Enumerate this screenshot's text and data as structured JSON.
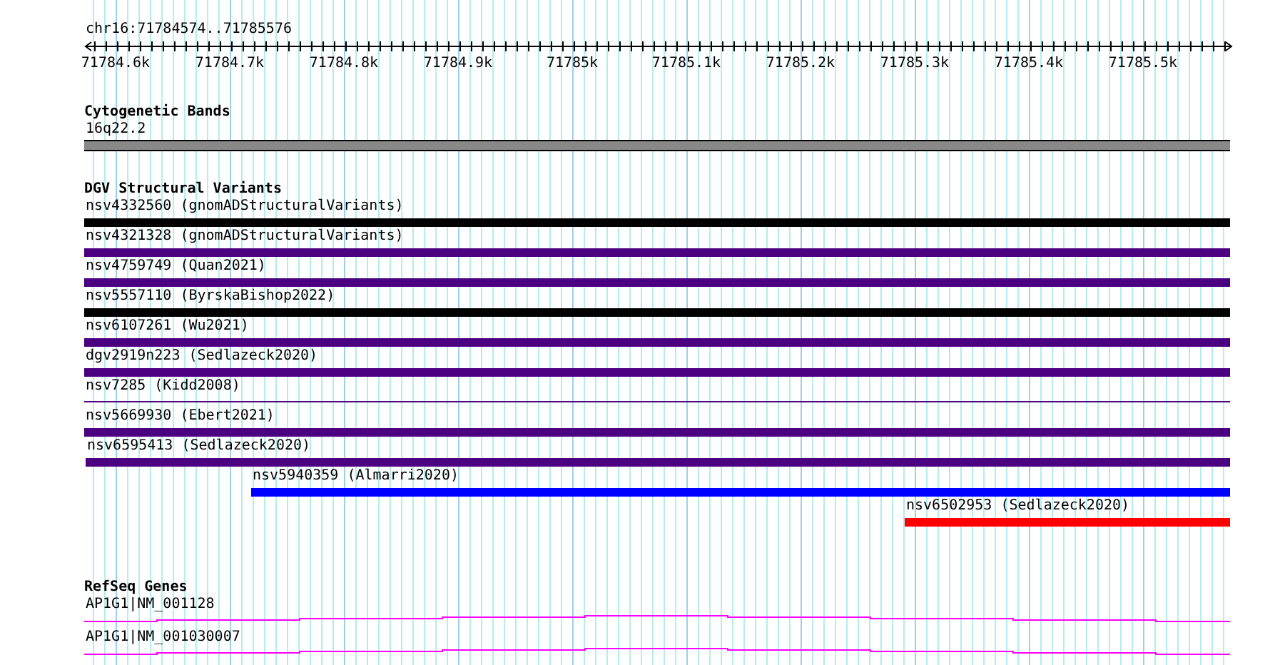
{
  "position": "chr16:71784574..71785576",
  "ruler": {
    "tick_labels": [
      "71784.6k",
      "71784.7k",
      "71784.8k",
      "71784.9k",
      "71785k",
      "71785.1k",
      "71785.2k",
      "71785.3k",
      "71785.4k",
      "71785.5k"
    ]
  },
  "cytogenetic_bands": {
    "title": "Cytogenetic Bands",
    "band": "16q22.2"
  },
  "dgv_structural_variants": {
    "title": "DGV Structural Variants",
    "items": [
      {
        "label": "nsv4332560 (gnomADStructuralVariants)",
        "color": "#000000",
        "kind": "thick"
      },
      {
        "label": "nsv4321328 (gnomADStructuralVariants)",
        "color": "#4b0082",
        "kind": "thick"
      },
      {
        "label": "nsv4759749 (Quan2021)",
        "color": "#4b0082",
        "kind": "thick"
      },
      {
        "label": "nsv5557110 (ByrskaBishop2022)",
        "color": "#000000",
        "kind": "thick"
      },
      {
        "label": "nsv6107261 (Wu2021)",
        "color": "#4b0082",
        "kind": "thick"
      },
      {
        "label": "dgv2919n223 (Sedlazeck2020)",
        "color": "#4b0082",
        "kind": "thick"
      },
      {
        "label": "nsv7285 (Kidd2008)",
        "color": "#4b0082",
        "kind": "thin"
      },
      {
        "label": "nsv5669930 (Ebert2021)",
        "color": "#4b0082",
        "kind": "thick"
      },
      {
        "label": "nsv6595413 (Sedlazeck2020)",
        "color": "#4b0082",
        "kind": "thick"
      },
      {
        "label": "nsv5940359 (Almarri2020)",
        "color": "#0000ff",
        "kind": "thick"
      },
      {
        "label": "nsv6502953 (Sedlazeck2020)",
        "color": "#ff0000",
        "kind": "thick"
      }
    ]
  },
  "refseq_genes": {
    "title": "RefSeq Genes",
    "items": [
      {
        "label": "AP1G1|NM_001128"
      },
      {
        "label": "AP1G1|NM_001030007"
      }
    ]
  }
}
